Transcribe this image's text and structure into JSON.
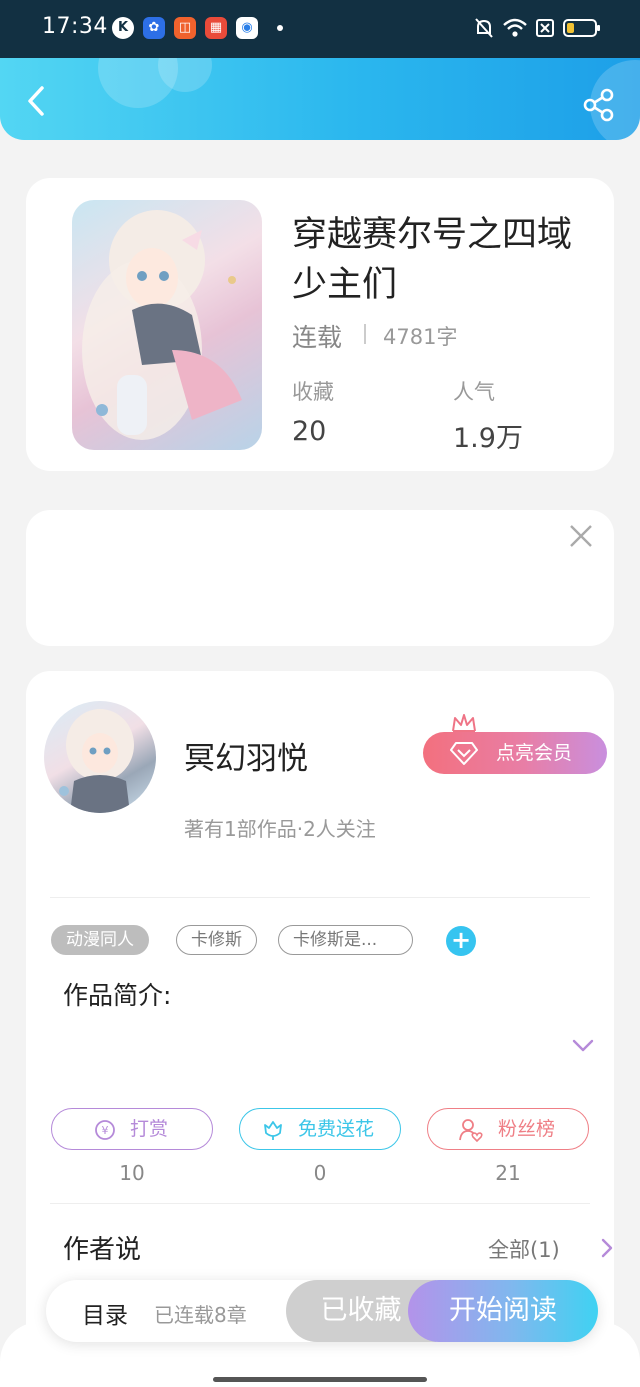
{
  "status_bar": {
    "time": "17:34",
    "app_icons": [
      "k-app-icon",
      "baidu-icon",
      "grid-app-icon",
      "store-app-icon",
      "circle-app-icon"
    ],
    "system_icons": [
      "mute-icon",
      "wifi-icon",
      "sim-icon",
      "battery-icon"
    ]
  },
  "header": {
    "back_icon": "chevron-left-icon",
    "share_icon": "share-icon"
  },
  "book": {
    "title": "穿越赛尔号之四域少主们",
    "status": "连载",
    "word_count": "4781字",
    "stats": [
      {
        "label": "收藏",
        "value": "20"
      },
      {
        "label": "人气",
        "value": "1.9万"
      }
    ]
  },
  "ad": {
    "close_icon": "close-icon"
  },
  "author": {
    "name": "冥幻羽悦",
    "meta": "著有1部作品·2人关注",
    "vip_button": "点亮会员",
    "tags": [
      "动漫同人",
      "卡修斯",
      "卡修斯是..."
    ],
    "intro_label": "作品简介:",
    "actions": [
      {
        "label": "打赏",
        "count": "10",
        "color": "#b58ad9"
      },
      {
        "label": "免费送花",
        "count": "0",
        "color": "#3cc6e8"
      },
      {
        "label": "粉丝榜",
        "count": "21",
        "color": "#ef7f86"
      }
    ],
    "author_says_label": "作者说",
    "see_all": "全部(1)"
  },
  "bottom_bar": {
    "toc": "目录",
    "chapters": "已连载8章",
    "collected": "已收藏",
    "start_reading": "开始阅读"
  },
  "colors": {
    "header_start": "#53d6f3",
    "header_end": "#1d9fe8",
    "accent_blue": "#36c4f0",
    "vip_pink": "#f3707e",
    "vip_purple": "#c98fde"
  }
}
